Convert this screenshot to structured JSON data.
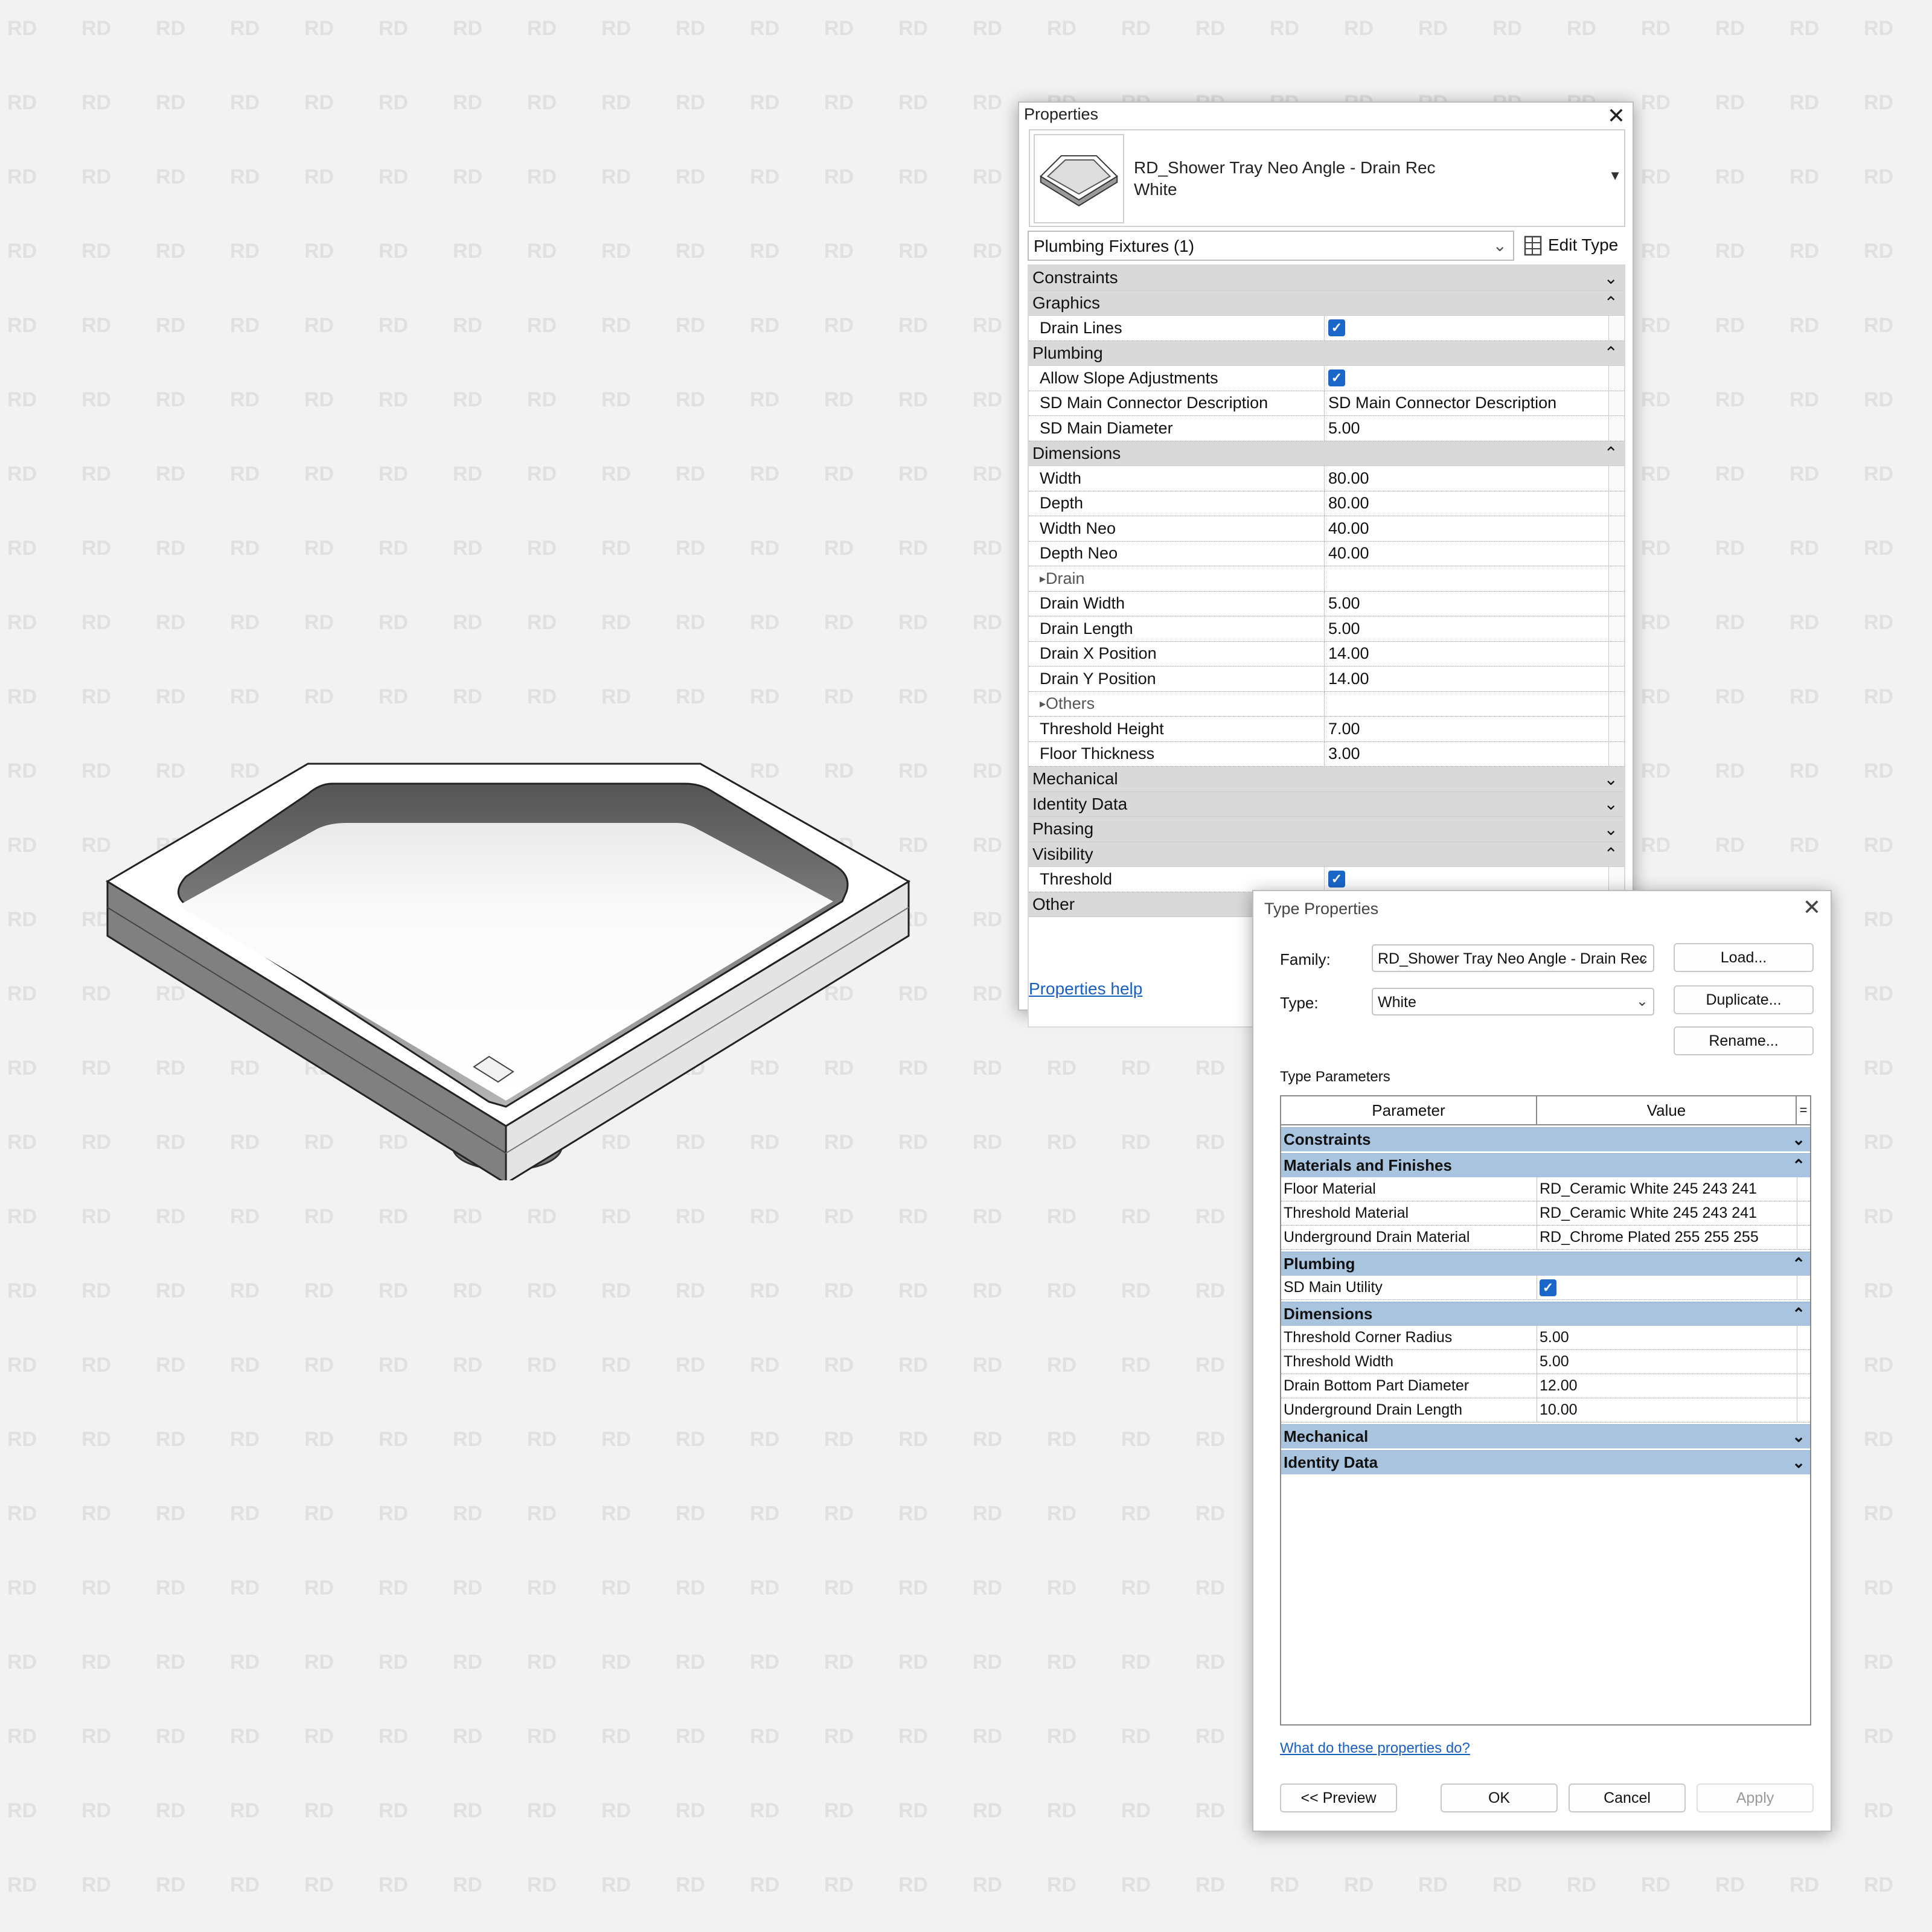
{
  "watermark": {
    "text": "RD"
  },
  "colors": {
    "accent": "#1a67c9",
    "section_blue": "#a9c4de",
    "link": "#1a5fc0"
  },
  "properties": {
    "title": "Properties",
    "family_line1": "RD_Shower Tray Neo Angle - Drain Rec",
    "family_line2": "White",
    "filter": "Plumbing Fixtures (1)",
    "edit_type": "Edit Type",
    "help": "Properties help",
    "rows": [
      {
        "kind": "section",
        "label": "Constraints",
        "state": "collapsed"
      },
      {
        "kind": "section",
        "label": "Graphics",
        "state": "expanded"
      },
      {
        "kind": "param",
        "label": "Drain Lines",
        "check": true
      },
      {
        "kind": "section",
        "label": "Plumbing",
        "state": "expanded"
      },
      {
        "kind": "param",
        "label": "Allow Slope Adjustments",
        "check": true
      },
      {
        "kind": "param",
        "label": "SD Main Connector Description",
        "value": "SD Main Connector Description"
      },
      {
        "kind": "param",
        "label": "SD Main Diameter",
        "value": "5.00"
      },
      {
        "kind": "section",
        "label": "Dimensions",
        "state": "expanded"
      },
      {
        "kind": "param",
        "label": "Width",
        "value": "80.00"
      },
      {
        "kind": "param",
        "label": "Depth",
        "value": "80.00"
      },
      {
        "kind": "param",
        "label": "Width Neo",
        "value": "40.00"
      },
      {
        "kind": "param",
        "label": "Depth Neo",
        "value": "40.00"
      },
      {
        "kind": "sub",
        "label": "Drain"
      },
      {
        "kind": "param",
        "label": "Drain Width",
        "value": "5.00"
      },
      {
        "kind": "param",
        "label": "Drain Length",
        "value": "5.00"
      },
      {
        "kind": "param",
        "label": "Drain X Position",
        "value": "14.00"
      },
      {
        "kind": "param",
        "label": "Drain Y Position",
        "value": "14.00"
      },
      {
        "kind": "sub",
        "label": "Others"
      },
      {
        "kind": "param",
        "label": "Threshold Height",
        "value": "7.00"
      },
      {
        "kind": "param",
        "label": "Floor Thickness",
        "value": "3.00"
      },
      {
        "kind": "section",
        "label": "Mechanical",
        "state": "collapsed"
      },
      {
        "kind": "section",
        "label": "Identity Data",
        "state": "collapsed"
      },
      {
        "kind": "section",
        "label": "Phasing",
        "state": "collapsed"
      },
      {
        "kind": "section",
        "label": "Visibility",
        "state": "expanded"
      },
      {
        "kind": "param",
        "label": "Threshold",
        "check": true
      },
      {
        "kind": "section",
        "label": "Other",
        "state": "collapsed"
      }
    ]
  },
  "type_properties": {
    "title": "Type Properties",
    "family_label": "Family:",
    "family_value": "RD_Shower Tray Neo Angle - Drain Rec",
    "type_label": "Type:",
    "type_value": "White",
    "load": "Load...",
    "duplicate": "Duplicate...",
    "rename": "Rename...",
    "params_label": "Type Parameters",
    "col_parameter": "Parameter",
    "col_value": "Value",
    "col_eq": "=",
    "help": "What do these properties do?",
    "preview": "<< Preview",
    "ok": "OK",
    "cancel": "Cancel",
    "apply": "Apply",
    "rows": [
      {
        "kind": "section",
        "label": "Constraints",
        "state": "collapsed"
      },
      {
        "kind": "section",
        "label": "Materials and Finishes",
        "state": "expanded"
      },
      {
        "kind": "param",
        "label": "Floor Material",
        "value": "RD_Ceramic White 245 243 241"
      },
      {
        "kind": "param",
        "label": "Threshold Material",
        "value": "RD_Ceramic White 245 243 241"
      },
      {
        "kind": "param",
        "label": "Underground Drain Material",
        "value": "RD_Chrome Plated 255 255 255"
      },
      {
        "kind": "section",
        "label": "Plumbing",
        "state": "expanded"
      },
      {
        "kind": "param",
        "label": "SD Main Utility",
        "check": true
      },
      {
        "kind": "section",
        "label": "Dimensions",
        "state": "expanded"
      },
      {
        "kind": "param",
        "label": "Threshold Corner Radius",
        "value": "5.00"
      },
      {
        "kind": "param",
        "label": "Threshold Width",
        "value": "5.00"
      },
      {
        "kind": "param",
        "label": "Drain Bottom Part Diameter",
        "value": "12.00"
      },
      {
        "kind": "param",
        "label": "Underground Drain Length",
        "value": "10.00"
      },
      {
        "kind": "section",
        "label": "Mechanical",
        "state": "collapsed"
      },
      {
        "kind": "section",
        "label": "Identity Data",
        "state": "collapsed"
      }
    ]
  }
}
